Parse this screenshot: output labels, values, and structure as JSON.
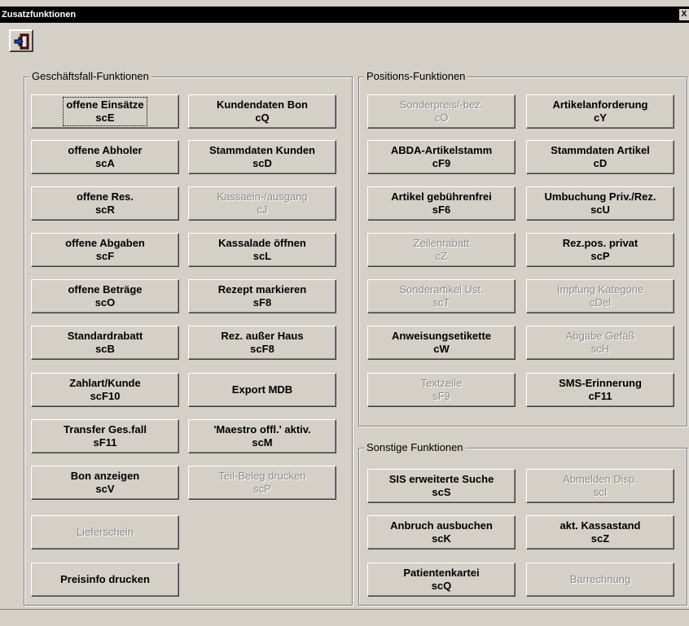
{
  "window": {
    "title": "Zusatzfunktionen",
    "close_label": "X"
  },
  "toolbar": {
    "exit_icon": "exit-door-icon"
  },
  "groups": {
    "geschaeftsfall": {
      "label": "Geschäftsfall-Funktionen"
    },
    "positions": {
      "label": "Positions-Funktionen"
    },
    "sonstige": {
      "label": "Sonstige Funktionen"
    }
  },
  "buttons": {
    "offene_einsaetze": {
      "label": "offene Einsätze",
      "shortcut": "scE"
    },
    "kundendaten_bon": {
      "label": "Kundendaten Bon",
      "shortcut": "cQ"
    },
    "offene_abholer": {
      "label": "offene Abholer",
      "shortcut": "scA"
    },
    "stammdaten_kunden": {
      "label": "Stammdaten Kunden",
      "shortcut": "scD"
    },
    "offene_res": {
      "label": "offene Res.",
      "shortcut": "scR"
    },
    "kassaein_ausgang": {
      "label": "Kassaein-/ausgang",
      "shortcut": "cJ"
    },
    "offene_abgaben": {
      "label": "offene Abgaben",
      "shortcut": "scF"
    },
    "kassalade_oeffnen": {
      "label": "Kassalade öffnen",
      "shortcut": "scL"
    },
    "offene_betraege": {
      "label": "offene Beträge",
      "shortcut": "scO"
    },
    "rezept_markieren": {
      "label": "Rezept markieren",
      "shortcut": "sF8"
    },
    "standardrabatt": {
      "label": "Standardrabatt",
      "shortcut": "scB"
    },
    "rez_ausser_haus": {
      "label": "Rez. außer Haus",
      "shortcut": "scF8"
    },
    "zahlart_kunde": {
      "label": "Zahlart/Kunde",
      "shortcut": "scF10"
    },
    "export_mdb": {
      "label": "Export MDB"
    },
    "transfer_gesfall": {
      "label": "Transfer Ges.fall",
      "shortcut": "sF11"
    },
    "maestro_offl": {
      "label": "'Maestro offl.' aktiv.",
      "shortcut": "scM"
    },
    "bon_anzeigen": {
      "label": "Bon anzeigen",
      "shortcut": "scV"
    },
    "teil_beleg": {
      "label": "Teil-Beleg drucken",
      "shortcut": "scP"
    },
    "lieferschein": {
      "label": "Lieferschein"
    },
    "preisinfo": {
      "label": "Preisinfo drucken"
    },
    "sonderpreis": {
      "label": "Sonderpreis/-bez.",
      "shortcut": "cO"
    },
    "artikelanforderung": {
      "label": "Artikelanforderung",
      "shortcut": "cY"
    },
    "abda_artikelstamm": {
      "label": "ABDA-Artikelstamm",
      "shortcut": "cF9"
    },
    "stammdaten_artikel": {
      "label": "Stammdaten Artikel",
      "shortcut": "cD"
    },
    "artikel_gebuehrenfrei": {
      "label": "Artikel gebührenfrei",
      "shortcut": "sF6"
    },
    "umbuchung": {
      "label": "Umbuchung Priv./Rez.",
      "shortcut": "scU"
    },
    "zeilenrabatt": {
      "label": "Zeilenrabatt",
      "shortcut": "cZ"
    },
    "rezpos_privat": {
      "label": "Rez.pos. privat",
      "shortcut": "scP"
    },
    "sonderartikel": {
      "label": "Sonderartikel Ust.",
      "shortcut": "scT"
    },
    "impfung": {
      "label": "Impfung Kategorie",
      "shortcut": "cDel"
    },
    "anweisungsetikette": {
      "label": "Anweisungsetikette",
      "shortcut": "cW"
    },
    "abgabe_gefaess": {
      "label": "Abgabe Gefäß",
      "shortcut": "scH"
    },
    "textzeile": {
      "label": "Textzeile",
      "shortcut": "sF9"
    },
    "sms_erinnerung": {
      "label": "SMS-Erinnerung",
      "shortcut": "cF11"
    },
    "sis_suche": {
      "label": "SIS erweiterte Suche",
      "shortcut": "scS"
    },
    "abmelden_disp": {
      "label": "Abmelden Disp.",
      "shortcut": "scI"
    },
    "anbruch_ausbuchen": {
      "label": "Anbruch ausbuchen",
      "shortcut": "scK"
    },
    "kassastand": {
      "label": "akt. Kassastand",
      "shortcut": "scZ"
    },
    "patientenkartei": {
      "label": "Patientenkartei",
      "shortcut": "scQ"
    },
    "barrechnung": {
      "label": "Barrechnung"
    }
  }
}
